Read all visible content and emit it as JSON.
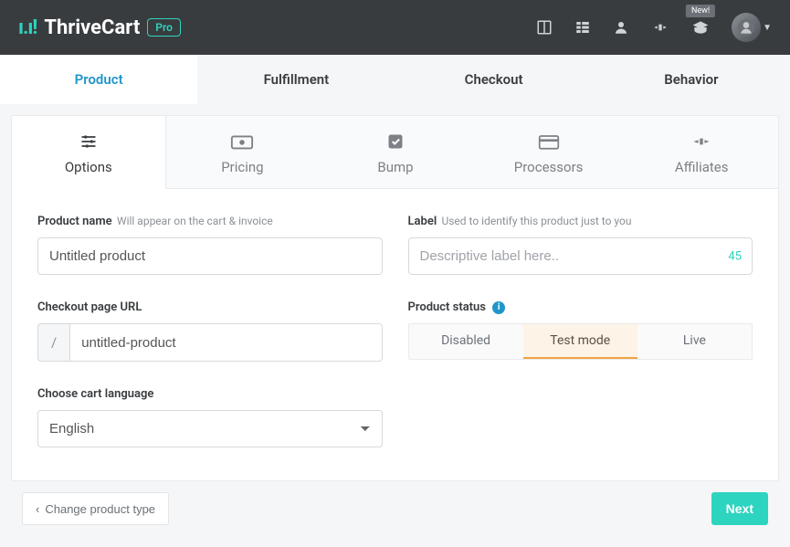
{
  "brand": {
    "name": "ThriveCart",
    "pro": "Pro",
    "new_badge": "New!"
  },
  "top_tabs": [
    "Product",
    "Fulfillment",
    "Checkout",
    "Behavior"
  ],
  "sub_tabs": [
    "Options",
    "Pricing",
    "Bump",
    "Processors",
    "Affiliates"
  ],
  "fields": {
    "product_name": {
      "label": "Product name",
      "hint": "Will appear on the cart & invoice",
      "value": "Untitled product"
    },
    "label": {
      "label": "Label",
      "hint": "Used to identify this product just to you",
      "placeholder": "Descriptive label here..",
      "count": "45"
    },
    "url": {
      "label": "Checkout page URL",
      "prefix": "/",
      "value": "untitled-product"
    },
    "status": {
      "label": "Product status",
      "options": [
        "Disabled",
        "Test mode",
        "Live"
      ]
    },
    "language": {
      "label": "Choose cart language",
      "value": "English"
    }
  },
  "footer": {
    "back": "Change product type",
    "next": "Next"
  }
}
